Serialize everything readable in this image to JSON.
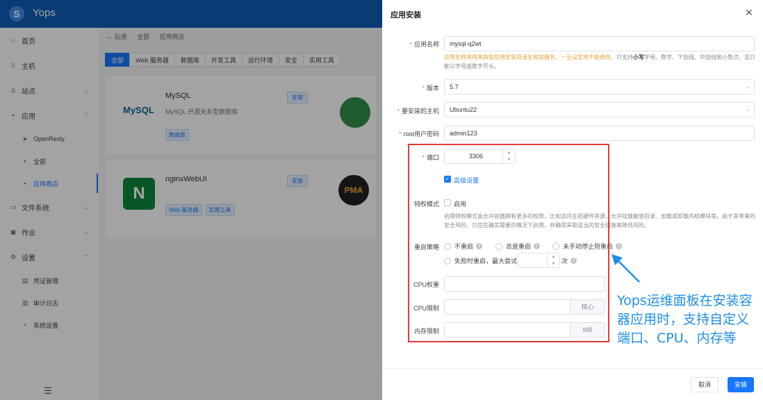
{
  "app": {
    "name": "Yops",
    "logo_glyph": "S"
  },
  "sidebar": {
    "items": [
      {
        "label": "首页",
        "icon": "home-icon",
        "glyph": "⌂"
      },
      {
        "label": "主机",
        "icon": "host-icon",
        "glyph": "▯"
      },
      {
        "label": "站点",
        "icon": "site-icon",
        "glyph": "♙",
        "arrow": "⌄"
      },
      {
        "label": "应用",
        "icon": "apps-icon",
        "glyph": "▪",
        "arrow": "⌃"
      },
      {
        "label": "OpenResty",
        "icon": "openresty-icon",
        "glyph": "➤"
      },
      {
        "label": "全部",
        "icon": "grid-icon",
        "glyph": "▪"
      },
      {
        "label": "应用商店",
        "icon": "store-icon",
        "glyph": "▪"
      },
      {
        "label": "文件系统",
        "icon": "folder-icon",
        "glyph": "▭",
        "arrow": "⌄"
      },
      {
        "label": "作业",
        "icon": "job-icon",
        "glyph": "▣",
        "arrow": "⌄"
      },
      {
        "label": "设置",
        "icon": "gear-icon",
        "glyph": "⚙",
        "arrow": "⌃"
      },
      {
        "label": "凭证管理",
        "icon": "credential-icon",
        "glyph": "▤"
      },
      {
        "label": "审计日志",
        "icon": "audit-icon",
        "glyph": "▥"
      },
      {
        "label": "系统设置",
        "icon": "system-settings-icon",
        "glyph": "⚬"
      }
    ],
    "menu_glyph": "☰"
  },
  "main": {
    "breadcrumb": [
      "← 后退",
      "全部",
      "应用商店"
    ],
    "tabs": [
      "全部",
      "Web 服务器",
      "数据库",
      "开发工具",
      "运行环境",
      "安全",
      "实用工具"
    ],
    "cards": [
      {
        "name": "MySQL",
        "desc": "MySQL 开源关系型数据库",
        "tags": [
          "数据库"
        ],
        "install": "安装",
        "logo_text": "MySQL"
      },
      {
        "name": "nginxWebUI",
        "desc": "",
        "tags": [
          "Web 服务器",
          "实用工具"
        ],
        "install": "安装",
        "logo_text": "N"
      }
    ],
    "peek_logo_text": "PMA"
  },
  "drawer": {
    "title": "应用安装",
    "close_glyph": "✕",
    "app_name": {
      "label": "应用名称",
      "value": "mysql-q2wt",
      "hint_warn": "应用名称将用来获取应用安装目录名和容器名，一旦设定将不能修改。",
      "hint_pre": "只支持",
      "hint_bold": "小写",
      "hint_post": "字母、数字、下划线、中划线和小数点，且只能以字母或数字开头。"
    },
    "version": {
      "label": "版本",
      "value": "5.7"
    },
    "host": {
      "label": "要安装的主机",
      "value": "Ubuntu22"
    },
    "root_password": {
      "label": "root用户密码",
      "value": "admin123"
    },
    "port": {
      "label": "端口",
      "value": "3306"
    },
    "advanced": {
      "label": "高级设置",
      "checked": true
    },
    "privileged": {
      "label": "特权模式",
      "checkbox_label": "启用",
      "hint": "启用特权模式会允许容器拥有更多的权限，比如访问主机硬件资源、允许挂载敏感目录、加载或卸载内核模块等。由于其带来的安全风险，只应在确实需要的情况下启用，并确保采取适当的安全措施来降低风险。"
    },
    "restart": {
      "label": "重启策略",
      "options": [
        "不重启",
        "总是重启",
        "未手动停止则重启"
      ],
      "on_failure_label": "失败时重启，最大尝试",
      "times_unit": "次"
    },
    "cpu_weight": {
      "label": "CPU权重",
      "value": ""
    },
    "cpu_limit": {
      "label": "CPU限制",
      "value": "",
      "unit": "核心"
    },
    "mem_limit": {
      "label": "内存限制",
      "value": "",
      "unit": "MB"
    },
    "cancel_label": "取消",
    "install_label": "安装"
  },
  "annotation": {
    "text": "Yops运维面板在安装容器应用时，支持自定义端口、CPU、内存等"
  },
  "colors": {
    "primary": "#1677ff",
    "topbar": "#0f5fb6",
    "annotation": "#1e8fe8",
    "highlight_box": "#e53935"
  }
}
